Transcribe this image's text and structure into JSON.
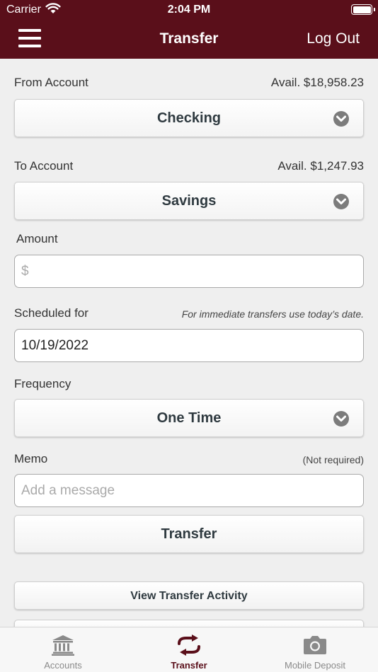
{
  "status_bar": {
    "carrier": "Carrier",
    "time": "2:04 PM"
  },
  "header": {
    "title": "Transfer",
    "logout_label": "Log Out"
  },
  "from_account": {
    "label": "From Account",
    "available": "Avail. $18,958.23",
    "selected": "Checking"
  },
  "to_account": {
    "label": "To Account",
    "available": "Avail. $1,247.93",
    "selected": "Savings"
  },
  "amount": {
    "label": "Amount",
    "placeholder": "$",
    "value": ""
  },
  "scheduled": {
    "label": "Scheduled for",
    "hint": "For immediate transfers use today’s date.",
    "value": "10/19/2022"
  },
  "frequency": {
    "label": "Frequency",
    "selected": "One Time"
  },
  "memo": {
    "label": "Memo",
    "hint": "(Not required)",
    "placeholder": "Add a message",
    "value": ""
  },
  "transfer_button": "Transfer",
  "view_activity_button": "View Transfer Activity",
  "tabbar": {
    "items": [
      {
        "label": "Accounts",
        "icon": "bank-icon"
      },
      {
        "label": "Transfer",
        "icon": "transfer-arrows-icon"
      },
      {
        "label": "Mobile Deposit",
        "icon": "camera-icon"
      }
    ],
    "active_index": 1
  },
  "colors": {
    "brand": "#5a0f1a",
    "background": "#efefef",
    "inactive_tab": "#8a8a8a"
  }
}
